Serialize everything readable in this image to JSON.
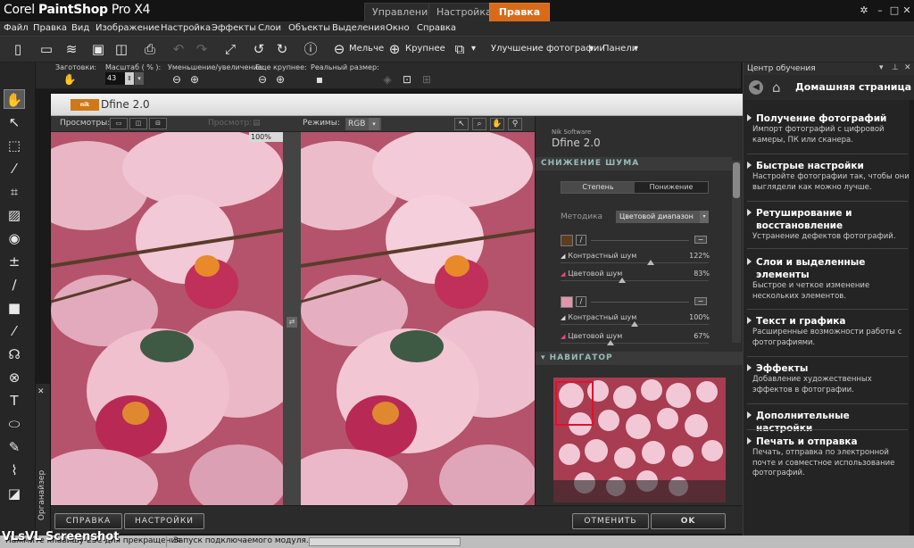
{
  "app": {
    "title_brand": "Corel ",
    "title_product": "PaintShop",
    "title_rest": " Pro X4"
  },
  "mode_tabs": [
    "Управление",
    "Настройка",
    "Правка"
  ],
  "menu": [
    "Файл",
    "Правка",
    "Вид",
    "Изображение",
    "Настройка",
    "Эффекты",
    "Слои",
    "Объекты",
    "Выделения",
    "Окно",
    "Справка"
  ],
  "toolbar": {
    "zoom_out": "Мельче",
    "zoom_in": "Крупнее",
    "enhance": "Улучшение фотографии",
    "panels": "Панели"
  },
  "options": {
    "presets": "Заготовки:",
    "scale": "Масштаб ( % ):",
    "scale_value": "43",
    "zoom_inout": "Уменьшение/увеличение:",
    "zoom_more": "Еще крупнее:",
    "actual_size": "Реальный размер:"
  },
  "organizer": "Органайзер",
  "dialog": {
    "title": "Dfine 2.0",
    "previews_label": "Просмотры:",
    "preview_label": "Просмотр:",
    "modes_label": "Режимы:",
    "mode_value": "RGB",
    "zoom_badge": "100%",
    "vendor": "Nik Software",
    "product": "Dfine 2.0",
    "noise_section": "СНИЖЕНИЕ ШУМА",
    "seg_degree": "Степень",
    "seg_reduce": "Понижение",
    "method_label": "Методика",
    "method_value": "Цветовой диапазон",
    "slider_labels": {
      "contrast": "Контрастный шум",
      "color": "Цветовой шум"
    },
    "color_points": [
      {
        "swatch": "#5e3d1e",
        "contrast": "122%",
        "color": "83%",
        "contrast_level": 0.61,
        "color_level": 0.415
      },
      {
        "swatch": "#e394a8",
        "contrast": "100%",
        "color": "67%",
        "contrast_level": 0.5,
        "color_level": 0.335
      }
    ],
    "navigator_section": "НАВИГАТОР",
    "btn_help": "СПРАВКА",
    "btn_settings": "НАСТРОЙКИ",
    "btn_cancel": "ОТМЕНИТЬ",
    "btn_ok": "OK"
  },
  "learning": {
    "header": "Центр обучения",
    "home": "Домашняя страница",
    "sections": [
      {
        "title": "Получение фотографий",
        "desc": "Импорт фотографий с цифровой камеры, ПК или сканера."
      },
      {
        "title": "Быстрые настройки",
        "desc": "Настройте фотографии так, чтобы они выглядели как можно лучше."
      },
      {
        "title": "Ретуширование и восстановление",
        "desc": "Устранение дефектов фотографий."
      },
      {
        "title": "Слои и выделенные элементы",
        "desc": "Быстрое и четкое изменение нескольких элементов."
      },
      {
        "title": "Текст и графика",
        "desc": "Расширенные возможности работы с фотографиями."
      },
      {
        "title": "Эффекты",
        "desc": "Добавление художественных эффектов в фотографии."
      },
      {
        "title": "Дополнительные настройки",
        "desc": ""
      },
      {
        "title": "Печать и отправка",
        "desc": "Печать, отправка по электронной почте и совместное использование фотографий."
      }
    ]
  },
  "status": {
    "left": "Нажмите клавишу ESC для прекращения",
    "middle": "Запуск подключаемого модуля..."
  },
  "watermark": "VLsVL Screenshot",
  "colors": {
    "accent": "#d86a1a",
    "nav_box": "#e01030"
  }
}
